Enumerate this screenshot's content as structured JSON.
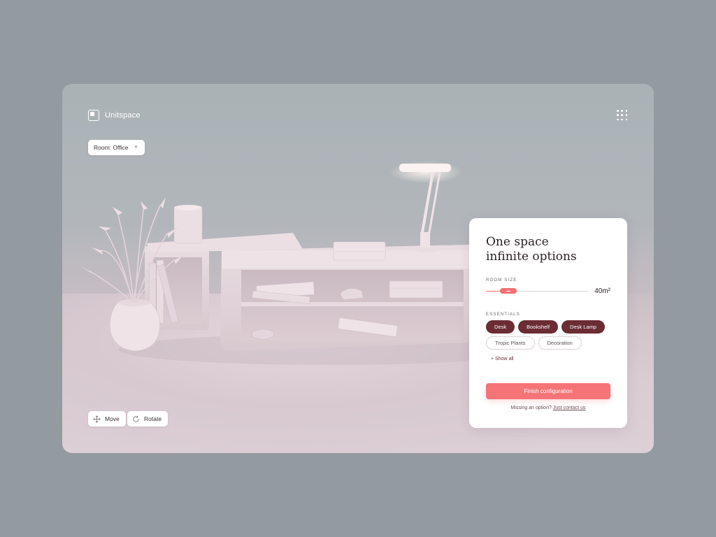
{
  "app": {
    "name": "Unitspace"
  },
  "room_select": {
    "label": "Room: Office"
  },
  "tools": {
    "move_label": "Move",
    "rotate_label": "Rotate"
  },
  "panel": {
    "title_line1": "One space",
    "title_line2": "infinite options",
    "room_size_label": "ROOM SIZE",
    "room_size_value": "40m²",
    "room_size_level": 0.16,
    "essentials_label": "ESSENTIALS",
    "chips": [
      {
        "label": "Desk",
        "selected": true
      },
      {
        "label": "Bookshelf",
        "selected": true
      },
      {
        "label": "Desk Lamp",
        "selected": true
      },
      {
        "label": "Tropic Plants",
        "selected": false
      },
      {
        "label": "Decoration",
        "selected": false
      }
    ],
    "show_all": "+ Show all",
    "finish_label": "Finish configuration",
    "missing_text": "Missing an option?",
    "contact_link": "Just contact us"
  },
  "colors": {
    "accent": "#f47477",
    "chip_selected": "#6b2c34",
    "background": "#939aa0"
  },
  "icons": {
    "logo": "unitspace-logo-icon",
    "menu": "grid-dots-icon",
    "dropdown": "chevron-down-icon",
    "move": "move-arrows-icon",
    "rotate": "rotate-icon"
  }
}
